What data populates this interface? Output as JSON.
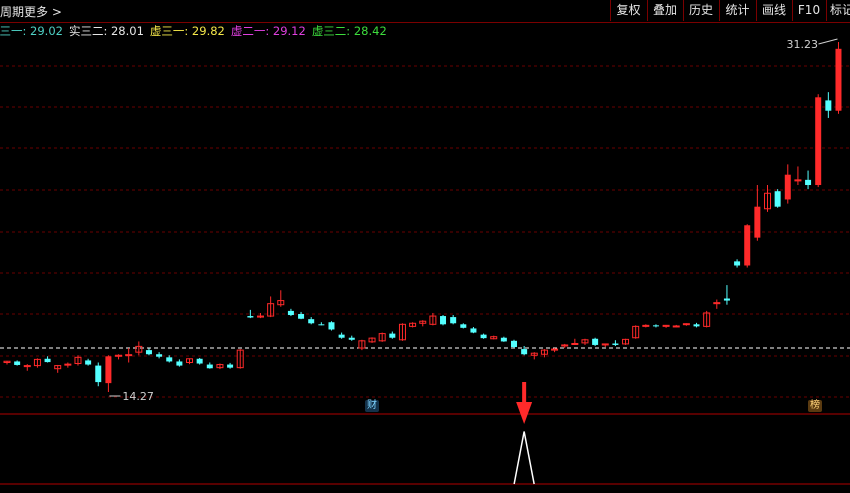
{
  "toolbar": {
    "period_label": "周期",
    "more_label": "更多",
    "more_icon": "chevron-right-icon",
    "buttons": [
      "复权",
      "叠加",
      "历史",
      "统计",
      "画线",
      "F10",
      "标记"
    ]
  },
  "legend": [
    {
      "label": "实三一:",
      "value": "29.02",
      "color": "#4fd1c5"
    },
    {
      "label": "实三二:",
      "value": "28.01",
      "color": "#e6e6e6"
    },
    {
      "label": "虚三一:",
      "value": "29.82",
      "color": "#f5e84a"
    },
    {
      "label": "虚二一:",
      "value": "29.12",
      "color": "#e040e0"
    },
    {
      "label": "虚三二:",
      "value": "28.42",
      "color": "#3ddc3d"
    }
  ],
  "price_labels": {
    "high": "31.23",
    "low": "14.27"
  },
  "badges": {
    "finance": "财",
    "rank": "榜"
  },
  "colors": {
    "up": "#ff2a2a",
    "down": "#54ffff",
    "grid": "#7a0000",
    "signal": "#ffffff",
    "arrow": "#ff2a2a"
  },
  "chart_data": {
    "type": "candlestick",
    "candles": [
      [
        15.7,
        15.78,
        15.6,
        15.76
      ],
      [
        15.75,
        15.8,
        15.55,
        15.58
      ],
      [
        15.5,
        15.62,
        15.3,
        15.55
      ],
      [
        15.55,
        15.9,
        15.45,
        15.85
      ],
      [
        15.88,
        16.0,
        15.7,
        15.72
      ],
      [
        15.4,
        15.58,
        15.2,
        15.55
      ],
      [
        15.58,
        15.7,
        15.45,
        15.62
      ],
      [
        15.65,
        16.05,
        15.55,
        15.95
      ],
      [
        15.8,
        15.88,
        15.55,
        15.6
      ],
      [
        15.55,
        15.7,
        14.55,
        14.75
      ],
      [
        14.7,
        16.05,
        14.27,
        16.0
      ],
      [
        16.0,
        16.1,
        15.85,
        16.05
      ],
      [
        16.05,
        16.4,
        15.7,
        16.08
      ],
      [
        16.2,
        16.72,
        16.05,
        16.48
      ],
      [
        16.3,
        16.38,
        16.05,
        16.1
      ],
      [
        16.1,
        16.2,
        15.9,
        15.98
      ],
      [
        15.95,
        16.05,
        15.7,
        15.75
      ],
      [
        15.75,
        15.85,
        15.5,
        15.55
      ],
      [
        15.7,
        15.9,
        15.62,
        15.88
      ],
      [
        15.88,
        15.92,
        15.6,
        15.65
      ],
      [
        15.6,
        15.7,
        15.4,
        15.42
      ],
      [
        15.45,
        15.65,
        15.38,
        15.6
      ],
      [
        15.6,
        15.68,
        15.4,
        15.45
      ],
      [
        15.45,
        16.35,
        15.4,
        16.3
      ],
      [
        17.95,
        18.25,
        17.85,
        17.88
      ],
      [
        17.9,
        18.1,
        17.85,
        17.95
      ],
      [
        17.95,
        18.9,
        17.9,
        18.55
      ],
      [
        18.5,
        19.2,
        18.4,
        18.7
      ],
      [
        18.2,
        18.3,
        17.95,
        18.0
      ],
      [
        18.05,
        18.15,
        17.8,
        17.82
      ],
      [
        17.8,
        17.9,
        17.55,
        17.6
      ],
      [
        17.55,
        17.65,
        17.5,
        17.52
      ],
      [
        17.65,
        17.7,
        17.25,
        17.3
      ],
      [
        17.05,
        17.15,
        16.85,
        16.9
      ],
      [
        16.9,
        17.0,
        16.75,
        16.8
      ],
      [
        16.4,
        16.8,
        16.3,
        16.75
      ],
      [
        16.7,
        16.92,
        16.65,
        16.88
      ],
      [
        16.75,
        17.15,
        16.7,
        17.1
      ],
      [
        17.1,
        17.2,
        16.85,
        16.9
      ],
      [
        16.8,
        17.6,
        16.75,
        17.55
      ],
      [
        17.45,
        17.65,
        17.4,
        17.6
      ],
      [
        17.6,
        17.75,
        17.45,
        17.7
      ],
      [
        17.55,
        18.1,
        17.5,
        17.95
      ],
      [
        17.95,
        18.0,
        17.5,
        17.55
      ],
      [
        17.9,
        18.0,
        17.55,
        17.6
      ],
      [
        17.55,
        17.6,
        17.35,
        17.38
      ],
      [
        17.35,
        17.42,
        17.12,
        17.15
      ],
      [
        17.05,
        17.1,
        16.85,
        16.88
      ],
      [
        16.85,
        17.0,
        16.82,
        16.95
      ],
      [
        16.9,
        16.95,
        16.7,
        16.72
      ],
      [
        16.75,
        16.8,
        16.4,
        16.45
      ],
      [
        16.35,
        16.5,
        16.05,
        16.1
      ],
      [
        16.05,
        16.2,
        15.85,
        16.15
      ],
      [
        16.1,
        16.35,
        15.95,
        16.3
      ],
      [
        16.3,
        16.4,
        16.2,
        16.35
      ],
      [
        16.5,
        16.6,
        16.4,
        16.55
      ],
      [
        16.6,
        16.85,
        16.55,
        16.62
      ],
      [
        16.65,
        16.85,
        16.55,
        16.8
      ],
      [
        16.85,
        16.9,
        16.5,
        16.55
      ],
      [
        16.55,
        16.62,
        16.45,
        16.6
      ],
      [
        16.62,
        16.78,
        16.5,
        16.55
      ],
      [
        16.6,
        16.85,
        16.55,
        16.82
      ],
      [
        16.9,
        17.5,
        16.85,
        17.45
      ],
      [
        17.45,
        17.55,
        17.4,
        17.5
      ],
      [
        17.5,
        17.55,
        17.4,
        17.45
      ],
      [
        17.45,
        17.52,
        17.38,
        17.5
      ],
      [
        17.45,
        17.52,
        17.4,
        17.47
      ],
      [
        17.55,
        17.6,
        17.48,
        17.58
      ],
      [
        17.55,
        17.62,
        17.4,
        17.45
      ],
      [
        17.45,
        18.2,
        17.4,
        18.1
      ],
      [
        18.55,
        18.75,
        18.3,
        18.6
      ],
      [
        18.8,
        19.45,
        18.5,
        18.7
      ],
      [
        20.6,
        20.7,
        20.3,
        20.4
      ],
      [
        20.4,
        22.4,
        20.3,
        22.35
      ],
      [
        21.75,
        24.3,
        21.6,
        23.25
      ],
      [
        23.15,
        24.3,
        23.0,
        23.9
      ],
      [
        24.0,
        24.1,
        23.2,
        23.25
      ],
      [
        23.6,
        25.3,
        23.4,
        24.8
      ],
      [
        24.5,
        25.2,
        24.3,
        24.55
      ],
      [
        24.55,
        25.0,
        24.1,
        24.3
      ],
      [
        24.3,
        28.7,
        24.2,
        28.55
      ],
      [
        28.4,
        28.8,
        27.55,
        27.9
      ],
      [
        27.9,
        31.23,
        27.75,
        30.9
      ]
    ],
    "price_high": 31.23,
    "price_low": 14.27,
    "dashed_reference_price": 16.4,
    "signal": {
      "candle_index": 51,
      "peak_fraction": 0.75
    }
  }
}
